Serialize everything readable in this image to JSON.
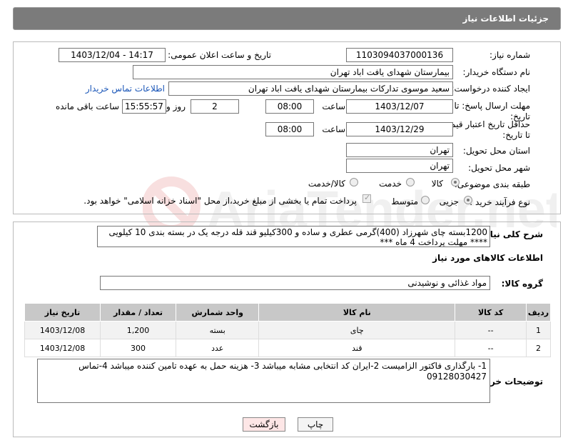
{
  "header": {
    "title": "جزئیات اطلاعات نیاز"
  },
  "form": {
    "need_number_label": "شماره نیاز:",
    "need_number": "1103094037000136",
    "announce_label": "تاریخ و ساعت اعلان عمومی:",
    "announce_value": "1403/12/04 - 14:17",
    "buyer_org_label": "نام دستگاه خریدار:",
    "buyer_org": "بیمارستان شهدای یافت اباد تهران",
    "requester_label": "ایجاد کننده درخواست:",
    "requester": "سعید موسوی تدارکات بیمارستان شهدای یافت اباد تهران",
    "contact_link": "اطلاعات تماس خریدار",
    "deadline_label": "مهلت ارسال پاسخ: تا تاریخ:",
    "deadline_date": "1403/12/07",
    "time_label": "ساعت",
    "deadline_time": "08:00",
    "days_value": "2",
    "days_label": "روز و",
    "remaining_time": "15:55:57",
    "remaining_label": "ساعت باقی مانده",
    "validity_label": "حداقل تاریخ اعتبار قیمت: تا تاریخ:",
    "validity_date": "1403/12/29",
    "validity_time": "08:00",
    "province_label": "استان محل تحویل:",
    "province": "تهران",
    "city_label": "شهر محل تحویل:",
    "city": "تهران",
    "category_label": "طبقه بندی موضوعی:",
    "category_options": [
      "کالا",
      "خدمت",
      "کالا/خدمت"
    ],
    "process_label": "نوع فرآیند خرید :",
    "process_options": [
      "جزیی",
      "متوسط"
    ],
    "payment_note": "پرداخت تمام یا بخشی از مبلغ خرید،از محل \"اسناد خزانه اسلامی\" خواهد بود."
  },
  "summary": {
    "label": "شرح کلی نیاز:",
    "line1": "1200بسته چای شهرزاد (400)گرمی عطری و ساده و 300کیلیو قند قله درجه یک در  بسته بندی 10 کیلویی",
    "line2": "**** مهلت پرداخت 4 ماه ***"
  },
  "goods": {
    "section_title": "اطلاعات کالاهای مورد نیاز",
    "group_label": "گروه کالا:",
    "group_value": "مواد غذائی و نوشیدنی",
    "columns": [
      "ردیف",
      "کد کالا",
      "نام کالا",
      "واحد شمارش",
      "تعداد / مقدار",
      "تاریخ نیاز"
    ],
    "rows": [
      [
        "1",
        "--",
        "چای",
        "بسته",
        "1,200",
        "1403/12/08"
      ],
      [
        "2",
        "--",
        "قند",
        "عدد",
        "300",
        "1403/12/08"
      ]
    ]
  },
  "buyer_notes": {
    "label": "توضیحات خریدار:",
    "line1": "1- بارگذاری فاکتور الزامیست 2-ایران  کد انتخابی مشابه میباشد 3- هزینه حمل به عهده تامین کننده میباشد 4-تماس",
    "line2": "09128030427"
  },
  "buttons": {
    "print": "چاپ",
    "back": "بازگشت"
  },
  "watermark_text": "AriaTender.net"
}
